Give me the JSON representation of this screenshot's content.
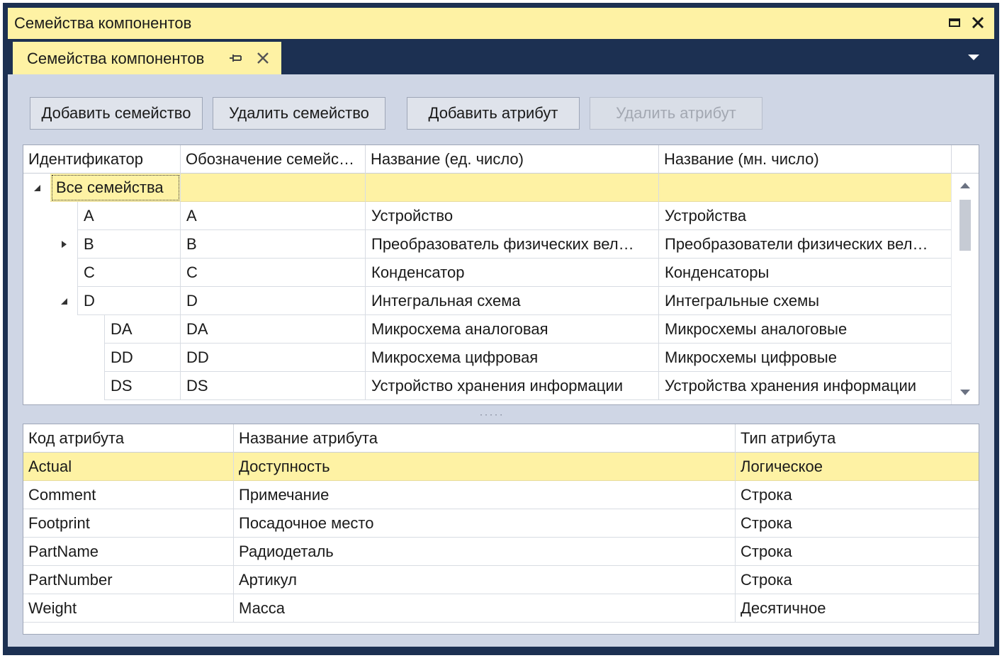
{
  "window": {
    "title": "Семейства компонентов"
  },
  "tabs": [
    {
      "label": "Семейства компонентов"
    }
  ],
  "toolbar": {
    "add_family": "Добавить семейство",
    "delete_family": "Удалить семейство",
    "add_attribute": "Добавить атрибут",
    "delete_attribute": "Удалить атрибут"
  },
  "families": {
    "columns": [
      "Идентификатор",
      "Обозначение семейс…",
      "Название (ед. число)",
      "Название (мн. число)"
    ],
    "rows": [
      {
        "id": "Все семейства",
        "code": "",
        "singular": "",
        "plural": "",
        "level": 0,
        "expander": "expanded",
        "selected": true
      },
      {
        "id": "A",
        "code": "A",
        "singular": "Устройство",
        "plural": "Устройства",
        "level": 1,
        "expander": "none"
      },
      {
        "id": "B",
        "code": "B",
        "singular": "Преобразователь физических вел…",
        "plural": "Преобразователи физических вел…",
        "level": 1,
        "expander": "collapsed"
      },
      {
        "id": "C",
        "code": "C",
        "singular": "Конденсатор",
        "plural": "Конденсаторы",
        "level": 1,
        "expander": "none"
      },
      {
        "id": "D",
        "code": "D",
        "singular": "Интегральная схема",
        "plural": "Интегральные схемы",
        "level": 1,
        "expander": "expanded"
      },
      {
        "id": "DA",
        "code": "DA",
        "singular": "Микросхема аналоговая",
        "plural": "Микросхемы аналоговые",
        "level": 2,
        "expander": "none"
      },
      {
        "id": "DD",
        "code": "DD",
        "singular": "Микросхема цифровая",
        "plural": "Микросхемы цифровые",
        "level": 2,
        "expander": "none"
      },
      {
        "id": "DS",
        "code": "DS",
        "singular": "Устройство хранения информации",
        "plural": "Устройства хранения информации",
        "level": 2,
        "expander": "none"
      }
    ]
  },
  "attributes": {
    "columns": [
      "Код атрибута",
      "Название атрибута",
      "Тип атрибута"
    ],
    "rows": [
      {
        "code": "Actual",
        "name": "Доступность",
        "type": "Логическое",
        "selected": true
      },
      {
        "code": "Comment",
        "name": "Примечание",
        "type": "Строка"
      },
      {
        "code": "Footprint",
        "name": "Посадочное место",
        "type": "Строка"
      },
      {
        "code": "PartName",
        "name": "Радиодеталь",
        "type": "Строка"
      },
      {
        "code": "PartNumber",
        "name": "Артикул",
        "type": "Строка"
      },
      {
        "code": "Weight",
        "name": "Масса",
        "type": "Десятичное"
      }
    ]
  },
  "splitter": {
    "glyph": "·····"
  },
  "colors": {
    "accent_yellow": "#fef2a4",
    "frame_navy": "#1c3052",
    "panel": "#cfd6e5"
  }
}
